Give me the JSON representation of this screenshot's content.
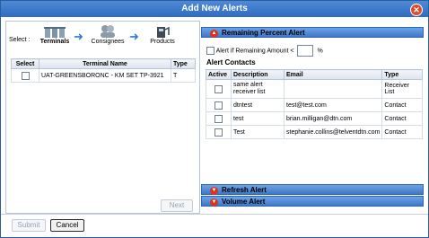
{
  "dialog": {
    "title": "Add New Alerts"
  },
  "wizard": {
    "select_label": "Select :",
    "steps": [
      "Terminals",
      "Consignees",
      "Products"
    ]
  },
  "terminals": {
    "columns": [
      "Select",
      "Terminal Name",
      "Type"
    ],
    "rows": [
      {
        "name": "UAT-GREENSBORONC - KM SET TP-3921",
        "type": "T"
      }
    ],
    "next_label": "Next"
  },
  "remaining": {
    "title": "Remaining Percent Alert",
    "checkbox_label": "Alert if Remaining Amount <",
    "unit": "%"
  },
  "contacts": {
    "title": "Alert Contacts",
    "columns": [
      "Active",
      "Description",
      "Email",
      "Type"
    ],
    "rows": [
      {
        "description": "same alert receiver list",
        "email": "",
        "type": "Receiver List"
      },
      {
        "description": "dtntest",
        "email": "test@test.com",
        "type": "Contact"
      },
      {
        "description": "test",
        "email": "brian.milligan@dtn.com",
        "type": "Contact"
      },
      {
        "description": "Test",
        "email": "stephanie.collins@telventdtn.com",
        "type": "Contact"
      }
    ]
  },
  "sections": {
    "refresh": "Refresh Alert",
    "volume": "Volume Alert"
  },
  "footer": {
    "submit": "Submit",
    "cancel": "Cancel"
  }
}
